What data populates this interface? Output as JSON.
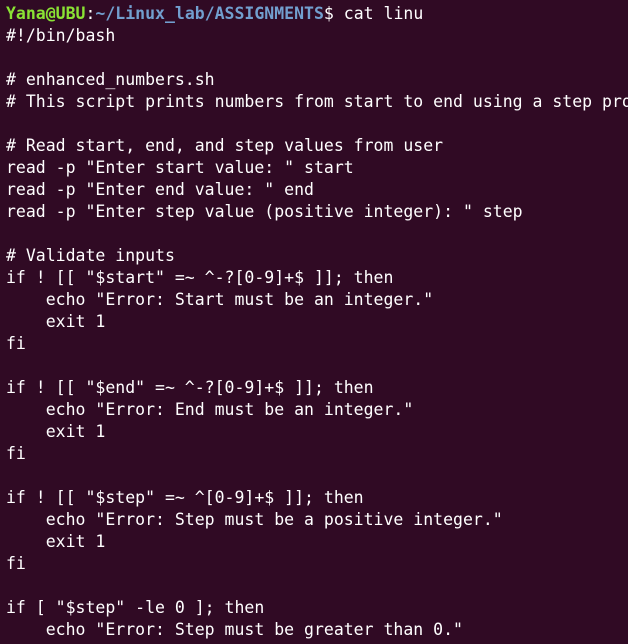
{
  "prompt": {
    "user_host": "Yana@UBU",
    "separator": ":",
    "path": "~/Linux_lab/ASSIGNMENTS",
    "symbol": "$ ",
    "command": "cat linu"
  },
  "output_lines": [
    "#!/bin/bash",
    "",
    "# enhanced_numbers.sh",
    "# This script prints numbers from start to end using a step pro",
    "",
    "# Read start, end, and step values from user",
    "read -p \"Enter start value: \" start",
    "read -p \"Enter end value: \" end",
    "read -p \"Enter step value (positive integer): \" step",
    "",
    "# Validate inputs",
    "if ! [[ \"$start\" =~ ^-?[0-9]+$ ]]; then",
    "    echo \"Error: Start must be an integer.\"",
    "    exit 1",
    "fi",
    "",
    "if ! [[ \"$end\" =~ ^-?[0-9]+$ ]]; then",
    "    echo \"Error: End must be an integer.\"",
    "    exit 1",
    "fi",
    "",
    "if ! [[ \"$step\" =~ ^[0-9]+$ ]]; then",
    "    echo \"Error: Step must be a positive integer.\"",
    "    exit 1",
    "fi",
    "",
    "if [ \"$step\" -le 0 ]; then",
    "    echo \"Error: Step must be greater than 0.\""
  ]
}
